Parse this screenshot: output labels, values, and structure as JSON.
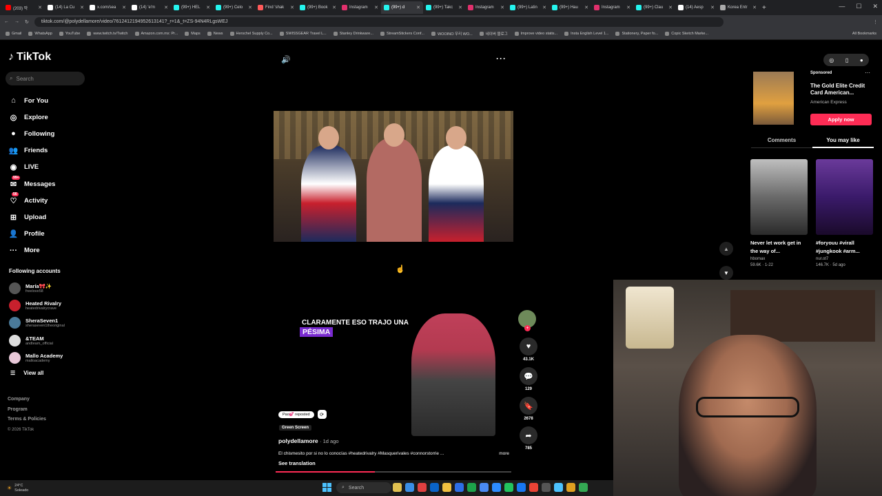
{
  "browser": {
    "tabs": [
      {
        "label": "(203) 막",
        "color": "#ff0000",
        "active": false
      },
      {
        "label": "(14) La Cu",
        "color": "#ffffff",
        "active": false
      },
      {
        "label": "x.com/sea",
        "color": "#ffffff",
        "active": false
      },
      {
        "label": "(14) 'e'm",
        "color": "#ffffff",
        "active": false
      },
      {
        "label": "(99+) HEL",
        "color": "#25f4ee",
        "active": false
      },
      {
        "label": "(99+) Celo",
        "color": "#25f4ee",
        "active": false
      },
      {
        "label": "Find 'shak",
        "color": "#ff5a5a",
        "active": false
      },
      {
        "label": "(99+) Book",
        "color": "#25f4ee",
        "active": false
      },
      {
        "label": "Instagram",
        "color": "#e1306c",
        "active": false
      },
      {
        "label": "(99+) d",
        "color": "#25f4ee",
        "active": true
      },
      {
        "label": "(99+) Takc",
        "color": "#25f4ee",
        "active": false
      },
      {
        "label": "Instagram",
        "color": "#e1306c",
        "active": false
      },
      {
        "label": "(99+) Latin",
        "color": "#25f4ee",
        "active": false
      },
      {
        "label": "(99+) Hau",
        "color": "#25f4ee",
        "active": false
      },
      {
        "label": "Instagram",
        "color": "#e1306c",
        "active": false
      },
      {
        "label": "(99+) Clau",
        "color": "#25f4ee",
        "active": false
      },
      {
        "label": "(14) Aesp",
        "color": "#ffffff",
        "active": false
      },
      {
        "label": "Korea Entr",
        "color": "#aaaaaa",
        "active": false
      }
    ],
    "url": "tiktok.com/@polydellamore/video/7612412194952613141?_r=1&_t=ZS-94N4RLgsWEJ",
    "bookmarks": [
      "Gmail",
      "WhatsApp",
      "YouTube",
      "www.twitch.tv/Twitch",
      "Amazon.com.mx: Pr...",
      "Maps",
      "News",
      "Herschel Supply Co...",
      "SWISSGEAR Travel L...",
      "Stanley Drinkware...",
      "StreamStickers Conf...",
      "WOOINO 우리 WO...",
      "네이버 블로그",
      "Improve video statis...",
      "Insta English Level 1...",
      "Stationery, Paper fo...",
      "Copic Sketch Marke..."
    ],
    "all_bookmarks": "All Bookmarks"
  },
  "sidebar": {
    "logo": "TikTok",
    "search_placeholder": "Search",
    "nav": [
      {
        "label": "For You",
        "icon": "home-icon"
      },
      {
        "label": "Explore",
        "icon": "compass-icon"
      },
      {
        "label": "Following",
        "icon": "avatar-icon"
      },
      {
        "label": "Friends",
        "icon": "friends-icon"
      },
      {
        "label": "LIVE",
        "icon": "live-icon"
      },
      {
        "label": "Messages",
        "icon": "messages-icon",
        "badge": "99+"
      },
      {
        "label": "Activity",
        "icon": "activity-icon",
        "badge": "56"
      },
      {
        "label": "Upload",
        "icon": "upload-icon"
      },
      {
        "label": "Profile",
        "icon": "profile-icon"
      },
      {
        "label": "More",
        "icon": "more-icon"
      }
    ],
    "following_title": "Following accounts",
    "accounts": [
      {
        "name": "María🎀✨",
        "handle": "freelove58",
        "color": "#555555"
      },
      {
        "name": "Heated Rivalry",
        "handle": "heatedrivalrycrave",
        "color": "#c8202d"
      },
      {
        "name": "SheraSeven1",
        "handle": "sheraseven1theoriginal",
        "color": "#4a7a9a"
      },
      {
        "name": "&TEAM",
        "handle": "andteam_official",
        "color": "#dddddd"
      },
      {
        "name": "Mallo Academy",
        "handle": "malloacademy",
        "color": "#e8c8d8"
      }
    ],
    "view_all": "View all",
    "footer": [
      "Company",
      "Program",
      "Terms & Policies"
    ],
    "copyright": "© 2026 TikTok"
  },
  "video2": {
    "caption_line1": "CLARAMENTE ESO TRAJO UNA",
    "caption_line2": "PÉSIMA",
    "reposted": "Pao💕 reposted",
    "green_screen": "Green Screen",
    "author": "polydellamore",
    "time": "· 1d ago",
    "description": "El chismesito por si no lo conocías #heatedrivalry #Masquerivales #connorstorrie ...",
    "more": "more",
    "see_translation": "See translation",
    "progress": 0.42,
    "likes": "43.1K",
    "comments": "129",
    "saves": "2678",
    "shares": "785"
  },
  "right": {
    "sponsored": "Sponsored",
    "ad_title": "The Gold Elite Credit Card American...",
    "ad_sub": "American Express",
    "ad_button": "Apply now",
    "tabs": [
      "Comments",
      "You may like"
    ],
    "suggested": [
      {
        "caption": "Never let work get in the way of...",
        "author": "hbomax",
        "meta": "59.6K · 1-22"
      },
      {
        "caption": "#foryouu #virall #jungkook #arm...",
        "author": "nur.ot7",
        "meta": "146.7K · 5d ago"
      }
    ]
  },
  "taskbar": {
    "temp": "24°C",
    "weather": "Soleado",
    "search": "Search"
  }
}
